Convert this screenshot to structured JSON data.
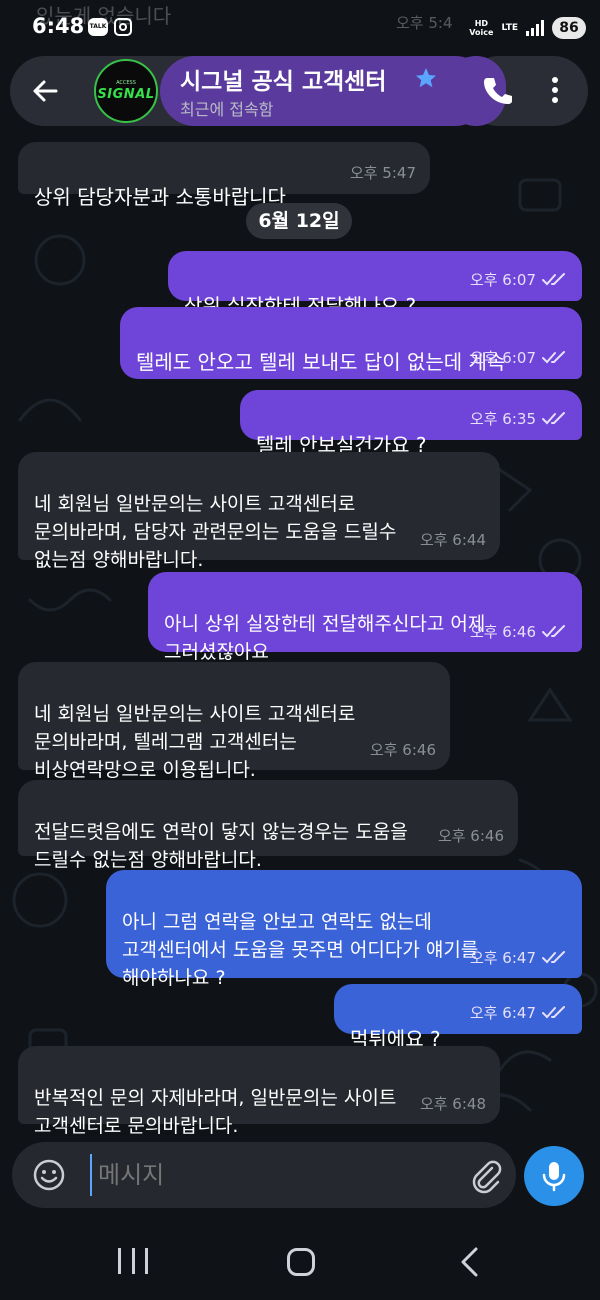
{
  "status_bar": {
    "time": "6:48",
    "talk_badge": "TALK",
    "hd_label": "HD",
    "voice_label": "Voice",
    "lte_label": "LTE",
    "battery": "86"
  },
  "background_text": {
    "partial_message": "있는게 없습니다",
    "partial_time": "오후 5:4"
  },
  "header": {
    "back_icon": "arrow-left-icon",
    "avatar_text": "SIGNAL",
    "avatar_top_text": "ACCESS",
    "title": "시그널 공식 고객센터",
    "verified_icon": "star-icon",
    "subtitle": "최근에 접속함",
    "call_icon": "phone-icon",
    "menu_icon": "more-vertical-icon"
  },
  "date_separator": "6월 12일",
  "messages": [
    {
      "text": "상위 담당자분과 소통바랍니다",
      "time": "오후 5:47",
      "dir": "in"
    },
    {
      "text": "상위 실장한테 전달했나요 ?",
      "time": "오후 6:07",
      "dir": "out"
    },
    {
      "text": "텔레도 안오고 텔레 보내도 답이 없는데 계속",
      "time": "오후 6:07",
      "dir": "out"
    },
    {
      "text": "텔레 안보실건가요 ?",
      "time": "오후 6:35",
      "dir": "out"
    },
    {
      "text": "네 회원님 일반문의는 사이트 고객센터로\n문의바라며, 담당자 관련문의는 도움을 드릴수\n없는점 양해바랍니다.",
      "time": "오후 6:44",
      "dir": "in"
    },
    {
      "text": "아니 상위 실장한테 전달해주신다고 어제\n그러셨잖아요",
      "time": "오후 6:46",
      "dir": "out"
    },
    {
      "text": "네 회원님 일반문의는 사이트 고객센터로\n문의바라며, 텔레그램 고객센터는\n비상연락망으로 이용됩니다.",
      "time": "오후 6:46",
      "dir": "in"
    },
    {
      "text": "전달드렷음에도 연락이 닿지 않는경우는 도움을\n드릴수 없는점 양해바랍니다.",
      "time": "오후 6:46",
      "dir": "in"
    },
    {
      "text": "아니 그럼 연락을 안보고 연락도 없는데\n고객센터에서 도움을 못주면 어디다가 얘기를\n해야하나요 ?",
      "time": "오후 6:47",
      "dir": "out"
    },
    {
      "text": "먹튀에요 ?",
      "time": "오후 6:47",
      "dir": "out"
    },
    {
      "text": "반복적인 문의 자제바라며, 일반문의는 사이트\n고객센터로 문의바랍니다.",
      "time": "오후 6:48",
      "dir": "in"
    }
  ],
  "composer": {
    "emoji_icon": "smile-icon",
    "placeholder": "메시지",
    "attach_icon": "paperclip-icon",
    "mic_icon": "microphone-icon"
  },
  "nav": {
    "recents_icon": "recents-icon",
    "home_icon": "home-icon",
    "back_icon": "back-chevron-icon"
  },
  "colors": {
    "outgoing_purple": "#6f45d9",
    "outgoing_blue": "#3b63d8",
    "incoming": "#26292f",
    "accent": "#2a90e8"
  }
}
